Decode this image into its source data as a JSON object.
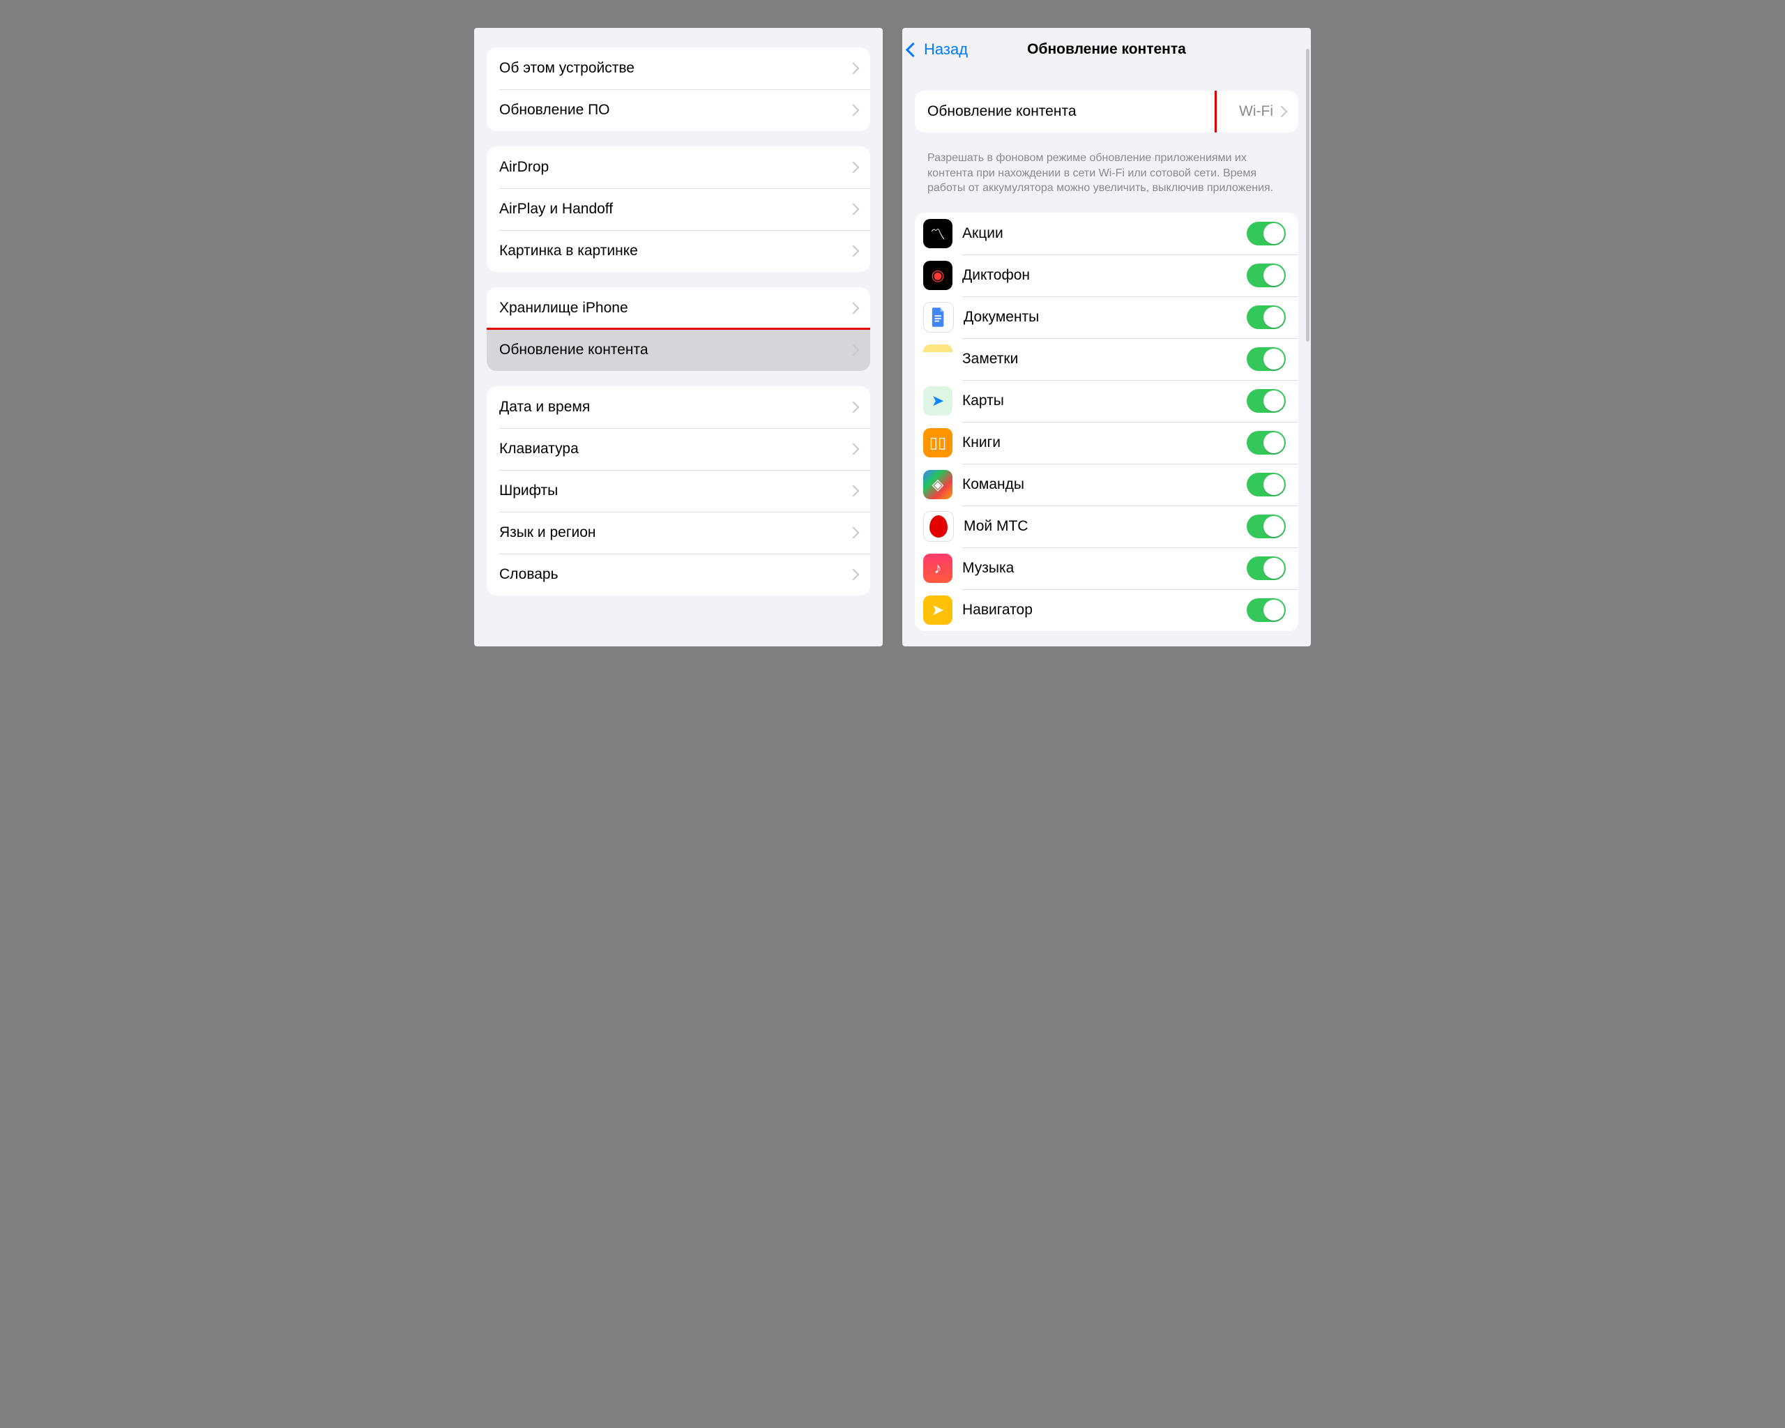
{
  "left": {
    "groups": [
      [
        {
          "label": "Об этом устройстве"
        },
        {
          "label": "Обновление ПО"
        }
      ],
      [
        {
          "label": "AirDrop"
        },
        {
          "label": "AirPlay и Handoff"
        },
        {
          "label": "Картинка в картинке"
        }
      ],
      [
        {
          "label": "Хранилище iPhone"
        },
        {
          "label": "Обновление контента",
          "selected": true
        }
      ],
      [
        {
          "label": "Дата и время"
        },
        {
          "label": "Клавиатура"
        },
        {
          "label": "Шрифты"
        },
        {
          "label": "Язык и регион"
        },
        {
          "label": "Словарь"
        }
      ]
    ]
  },
  "right": {
    "back": "Назад",
    "title": "Обновление контента",
    "setting": {
      "label": "Обновление контента",
      "value": "Wi-Fi"
    },
    "footer": "Разрешать в фоновом режиме обновление приложениями их контента при нахождении в сети Wi-Fi или сотовой сети. Время работы от аккумулятора можно увеличить, выключив приложения.",
    "apps": [
      {
        "label": "Акции",
        "icon": "ic-stocks",
        "glyph": "〽︎",
        "on": true
      },
      {
        "label": "Диктофон",
        "icon": "ic-voice",
        "glyph": "◉",
        "on": true
      },
      {
        "label": "Документы",
        "icon": "ic-docs",
        "glyph": "",
        "on": true
      },
      {
        "label": "Заметки",
        "icon": "ic-notes",
        "glyph": "",
        "on": true
      },
      {
        "label": "Карты",
        "icon": "ic-maps",
        "glyph": "➤",
        "on": true
      },
      {
        "label": "Книги",
        "icon": "ic-books",
        "glyph": "▯▯",
        "on": true
      },
      {
        "label": "Команды",
        "icon": "ic-shortcuts",
        "glyph": "◈",
        "on": true
      },
      {
        "label": "Мой МТС",
        "icon": "ic-mts",
        "glyph": "",
        "on": true
      },
      {
        "label": "Музыка",
        "icon": "ic-music",
        "glyph": "♪",
        "on": true
      },
      {
        "label": "Навигатор",
        "icon": "ic-nav",
        "glyph": "➤",
        "on": true
      }
    ]
  }
}
